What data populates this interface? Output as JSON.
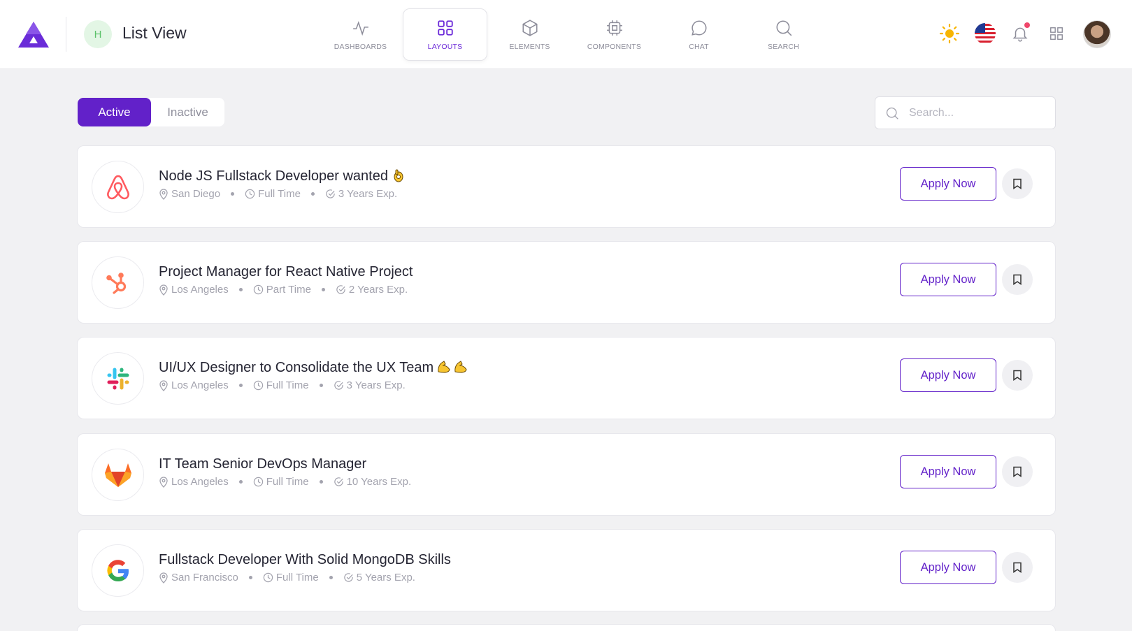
{
  "header": {
    "page_avatar_letter": "H",
    "page_title": "List View",
    "nav": [
      {
        "label": "DASHBOARDS",
        "icon": "activity-icon",
        "active": false
      },
      {
        "label": "LAYOUTS",
        "icon": "grid-icon",
        "active": true
      },
      {
        "label": "ELEMENTS",
        "icon": "cube-icon",
        "active": false
      },
      {
        "label": "COMPONENTS",
        "icon": "chip-icon",
        "active": false
      },
      {
        "label": "CHAT",
        "icon": "chat-icon",
        "active": false
      },
      {
        "label": "SEARCH",
        "icon": "search-icon",
        "active": false
      }
    ]
  },
  "tabs": [
    {
      "label": "Active",
      "active": true
    },
    {
      "label": "Inactive",
      "active": false
    }
  ],
  "search": {
    "placeholder": "Search..."
  },
  "jobs": [
    {
      "title": "Node JS Fullstack Developer wanted",
      "emoji": "ok-hand",
      "location": "San Diego",
      "type": "Full Time",
      "experience": "3 Years Exp.",
      "company_icon": "airbnb-logo-icon",
      "apply_label": "Apply Now"
    },
    {
      "title": "Project Manager for React Native Project",
      "emoji": "",
      "location": "Los Angeles",
      "type": "Part Time",
      "experience": "2 Years Exp.",
      "company_icon": "hubspot-logo-icon",
      "apply_label": "Apply Now"
    },
    {
      "title": "UI/UX Designer to Consolidate the UX Team",
      "emoji": "flexed-biceps",
      "location": "Los Angeles",
      "type": "Full Time",
      "experience": "3 Years Exp.",
      "company_icon": "slack-logo-icon",
      "apply_label": "Apply Now"
    },
    {
      "title": "IT Team Senior DevOps Manager",
      "emoji": "",
      "location": "Los Angeles",
      "type": "Full Time",
      "experience": "10 Years Exp.",
      "company_icon": "gitlab-logo-icon",
      "apply_label": "Apply Now"
    },
    {
      "title": "Fullstack Developer With Solid MongoDB Skills",
      "emoji": "",
      "location": "San Francisco",
      "type": "Full Time",
      "experience": "5 Years Exp.",
      "company_icon": "google-logo-icon",
      "apply_label": "Apply Now"
    }
  ],
  "colors": {
    "accent": "#6221c9",
    "background": "#f1f1f3",
    "notification": "#f0476b"
  }
}
